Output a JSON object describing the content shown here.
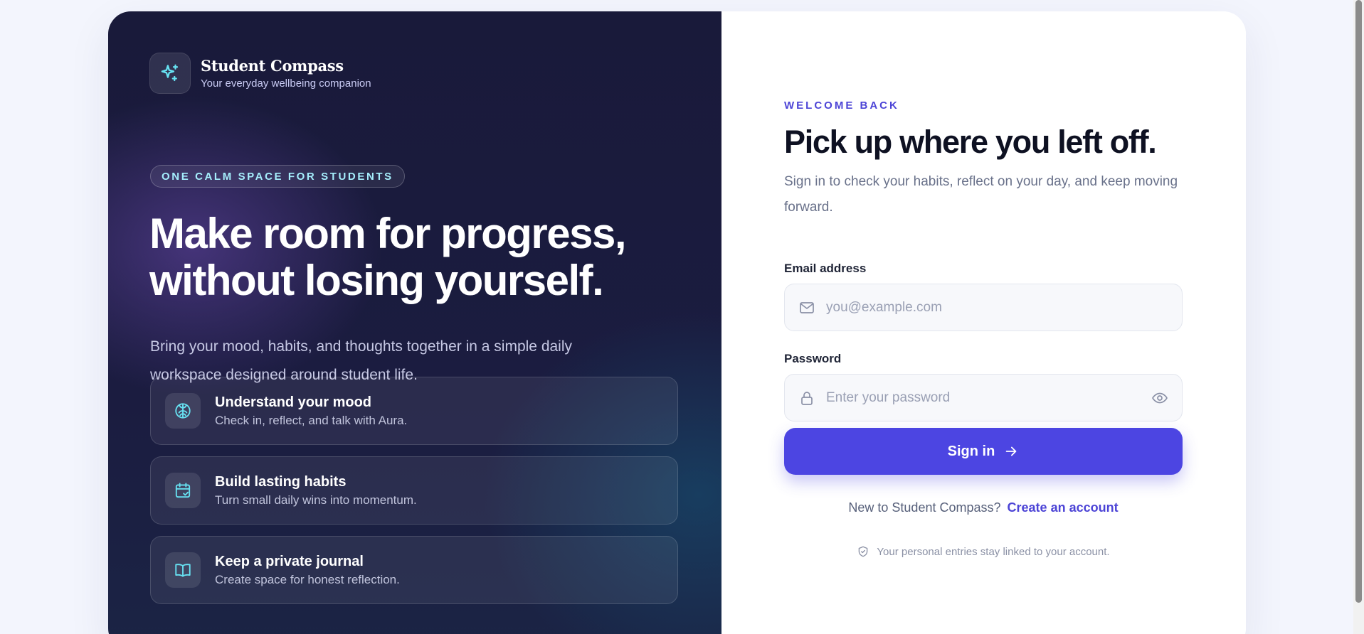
{
  "brand": {
    "name": "Student Compass",
    "tagline": "Your everyday wellbeing companion",
    "icon": "sparkles-icon"
  },
  "hero": {
    "pill": "ONE CALM SPACE FOR STUDENTS",
    "title_line1": "Make room for progress,",
    "title_line2": "without losing yourself.",
    "subtitle": "Bring your mood, habits, and thoughts together in a simple daily workspace designed around student life."
  },
  "features": [
    {
      "title": "Understand your mood",
      "desc": "Check in, reflect, and talk with Aura.",
      "icon": "brain-icon"
    },
    {
      "title": "Build lasting habits",
      "desc": "Turn small daily wins into momentum.",
      "icon": "calendar-check-icon"
    },
    {
      "title": "Keep a private journal",
      "desc": "Create space for honest reflection.",
      "icon": "book-open-icon"
    }
  ],
  "login": {
    "eyebrow": "WELCOME BACK",
    "title": "Pick up where you left off.",
    "description": "Sign in to check your habits, reflect on your day, and keep moving forward.",
    "email_label": "Email address",
    "email_placeholder": "you@example.com",
    "email_value": "",
    "password_label": "Password",
    "password_placeholder": "Enter your password",
    "password_value": "",
    "signin_label": "Sign in",
    "register_prompt": "New to Student Compass?",
    "register_link": "Create an account",
    "privacy_note": "Your personal entries stay linked to your account."
  },
  "colors": {
    "accent": "#4c45e2",
    "accent_text": "#4c44d6",
    "left_bg": "#1b1c40",
    "icon_cyan": "#67e3f3",
    "page_bg": "#f3f5fd"
  }
}
